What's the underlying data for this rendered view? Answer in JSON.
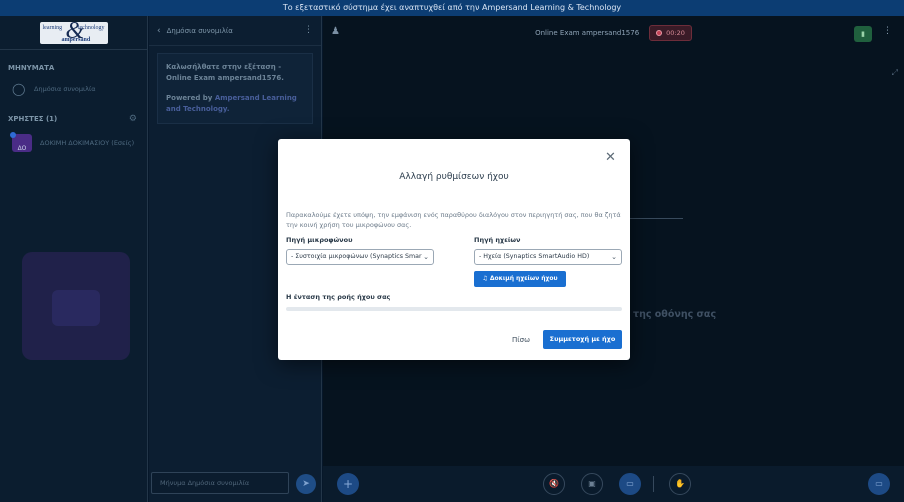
{
  "banner": {
    "text": "Το εξεταστικό σύστημα έχει αναπτυχθεί από την Ampersand Learning & Technology"
  },
  "logo": {
    "line1": "learning",
    "line2": "technology",
    "amp": "&",
    "line3": "ampersand"
  },
  "sidebar": {
    "messages_title": "ΜΗΝΥΜΑΤΑ",
    "public_chat": "Δημόσια συνομιλία",
    "users_title": "ΧΡΗΣΤΕΣ (1)",
    "user_name": "ΔΟΚΙΜΗ ΔΟΚΙΜΑΣΙΟΥ (Εσείς)",
    "user_initials": "ΔΟ"
  },
  "chat": {
    "header": "Δημόσια συνομιλία",
    "welcome_line1": "Καλωσήλθατε στην εξέταση",
    "welcome_exam": " - Online Exam ampersand1576.",
    "welcome_powered": "Powered by ",
    "welcome_company": "Ampersand Learning and Technology.",
    "input_placeholder": "Μήνυμα Δημόσια συνομιλία"
  },
  "main": {
    "title": "Online Exam ampersand1576",
    "timer": "00:20",
    "share_text": "της οθόνης σας"
  },
  "modal": {
    "title": "Αλλαγή ρυθμίσεων ήχου",
    "note": "Παρακαλούμε έχετε υπόψη, την εμφάνιση ενός παραθύρου διαλόγου στον περιηγητή σας, που θα ζητά την κοινή χρήση του μικροφώνου σας.",
    "mic_label": "Πηγή μικροφώνου",
    "mic_value": "- Συστοιχία μικροφώνων (Synaptics Smar",
    "speaker_label": "Πηγή ηχείων",
    "speaker_value": "- Ηχεία (Synaptics SmartAudio HD)",
    "test_button": "Δοκιμή ηχείων ήχου",
    "volume_label": "Η ένταση της ροής ήχου σας",
    "back_button": "Πίσω",
    "join_button": "Συμμετοχή με ήχο"
  }
}
